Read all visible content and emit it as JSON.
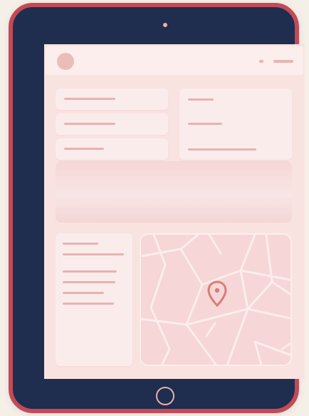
{
  "device": {
    "type": "tablet",
    "frame_color": "#c44a57",
    "bezel_color": "#1f2d4f",
    "screen_color": "#f9e3e1"
  },
  "map": {
    "pin_icon": "map-pin-icon",
    "pin_color": "#d87d77"
  }
}
